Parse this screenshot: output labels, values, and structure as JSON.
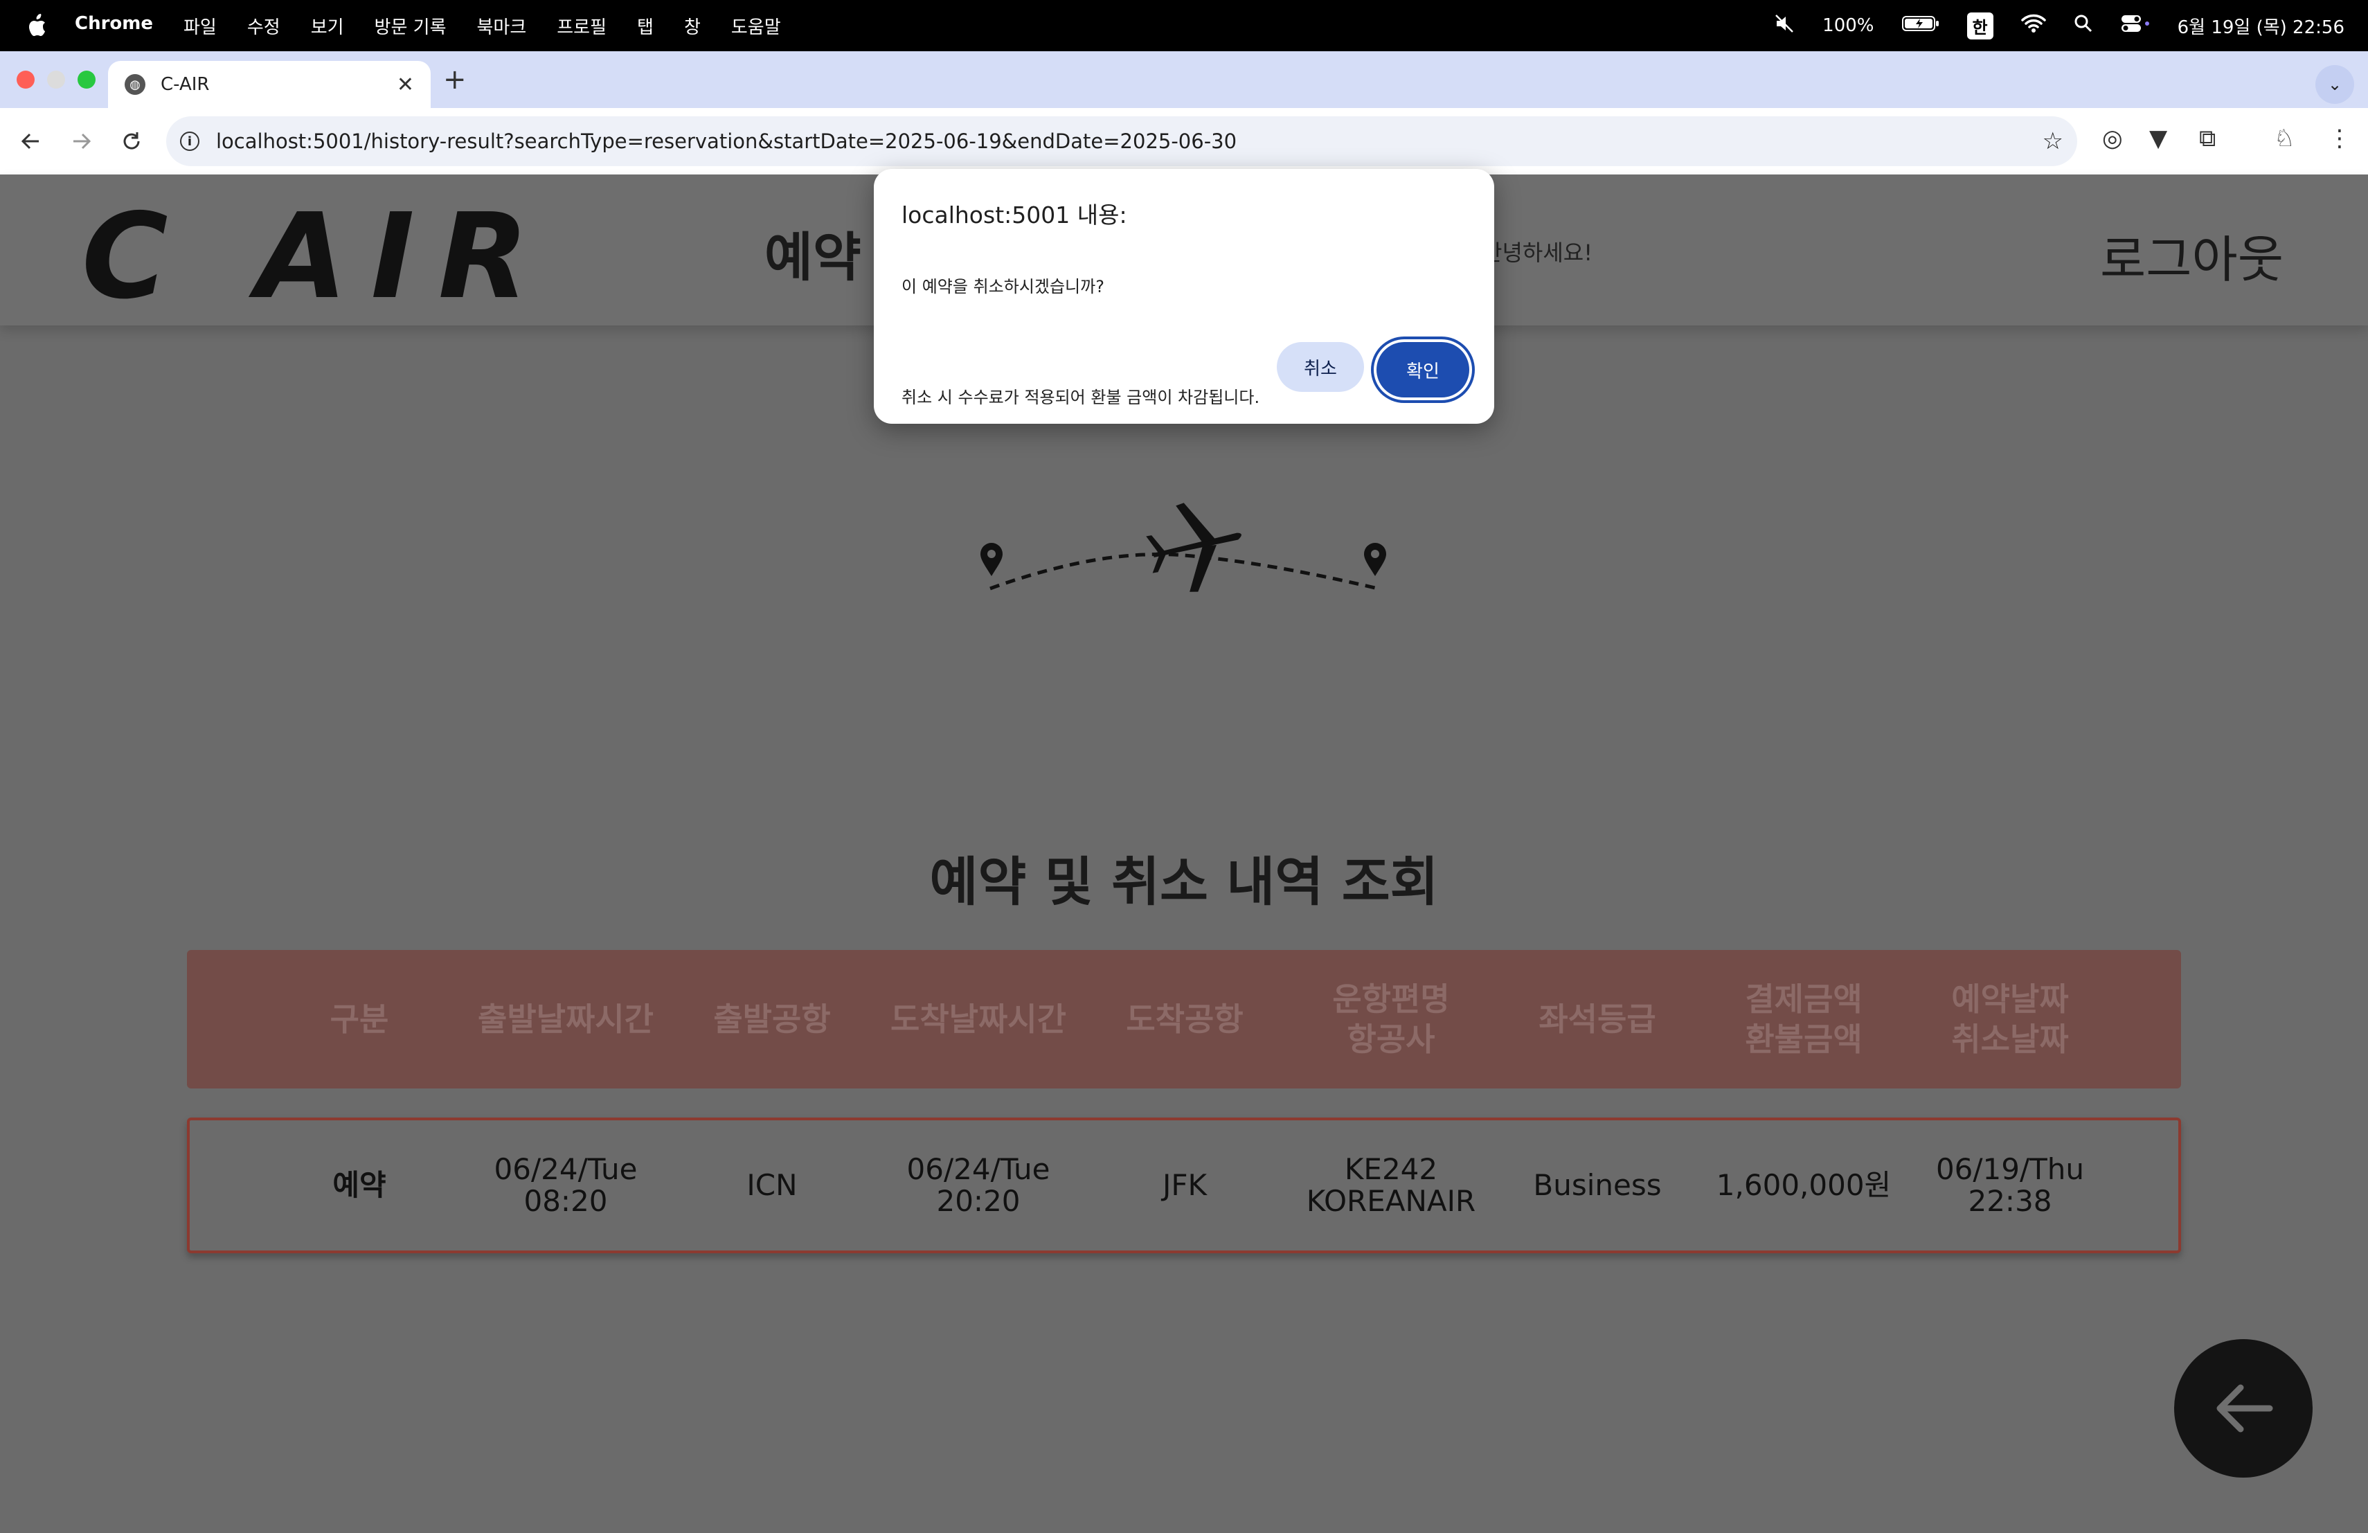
{
  "menubar": {
    "app": "Chrome",
    "items": [
      "파일",
      "수정",
      "보기",
      "방문 기록",
      "북마크",
      "프로필",
      "탭",
      "창",
      "도움말"
    ],
    "battery": "100%",
    "input_lang": "한",
    "datetime": "6월 19일 (목) 22:56"
  },
  "browser": {
    "tab_title": "C-AIR",
    "url": "localhost:5001/history-result?searchType=reservation&startDate=2025-06-19&endDate=2025-06-30"
  },
  "header": {
    "logo": "C AIR",
    "nav_reservation": "예약",
    "greeting": "안녕하세요!",
    "logout": "로그아웃"
  },
  "page": {
    "title": "예약 및 취소 내역 조회"
  },
  "table": {
    "headers": [
      [
        "구분"
      ],
      [
        "출발날짜시간"
      ],
      [
        "출발공항"
      ],
      [
        "도착날짜시간"
      ],
      [
        "도착공항"
      ],
      [
        "운항편명",
        "항공사"
      ],
      [
        "좌석등급"
      ],
      [
        "결제금액",
        "환불금액"
      ],
      [
        "예약날짜",
        "취소날짜"
      ]
    ],
    "rows": [
      [
        [
          "예약"
        ],
        [
          "06/24/Tue",
          "08:20"
        ],
        [
          "ICN"
        ],
        [
          "06/24/Tue",
          "20:20"
        ],
        [
          "JFK"
        ],
        [
          "KE242",
          "KOREANAIR"
        ],
        [
          "Business"
        ],
        [
          "1,600,000원"
        ],
        [
          "06/19/Thu",
          "22:38"
        ]
      ]
    ]
  },
  "dialog": {
    "title": "localhost:5001 내용:",
    "line1": "이 예약을 취소하시겠습니까?",
    "line2": "취소 시 수수료가 적용되어 환불 금액이 차감됩니다.",
    "cancel_label": "취소",
    "ok_label": "확인"
  },
  "colors": {
    "overlay_bg": "#6b6b6b",
    "table_header": "#734c48",
    "row_border": "#8c3a30",
    "ok_button": "#1d4db0"
  }
}
